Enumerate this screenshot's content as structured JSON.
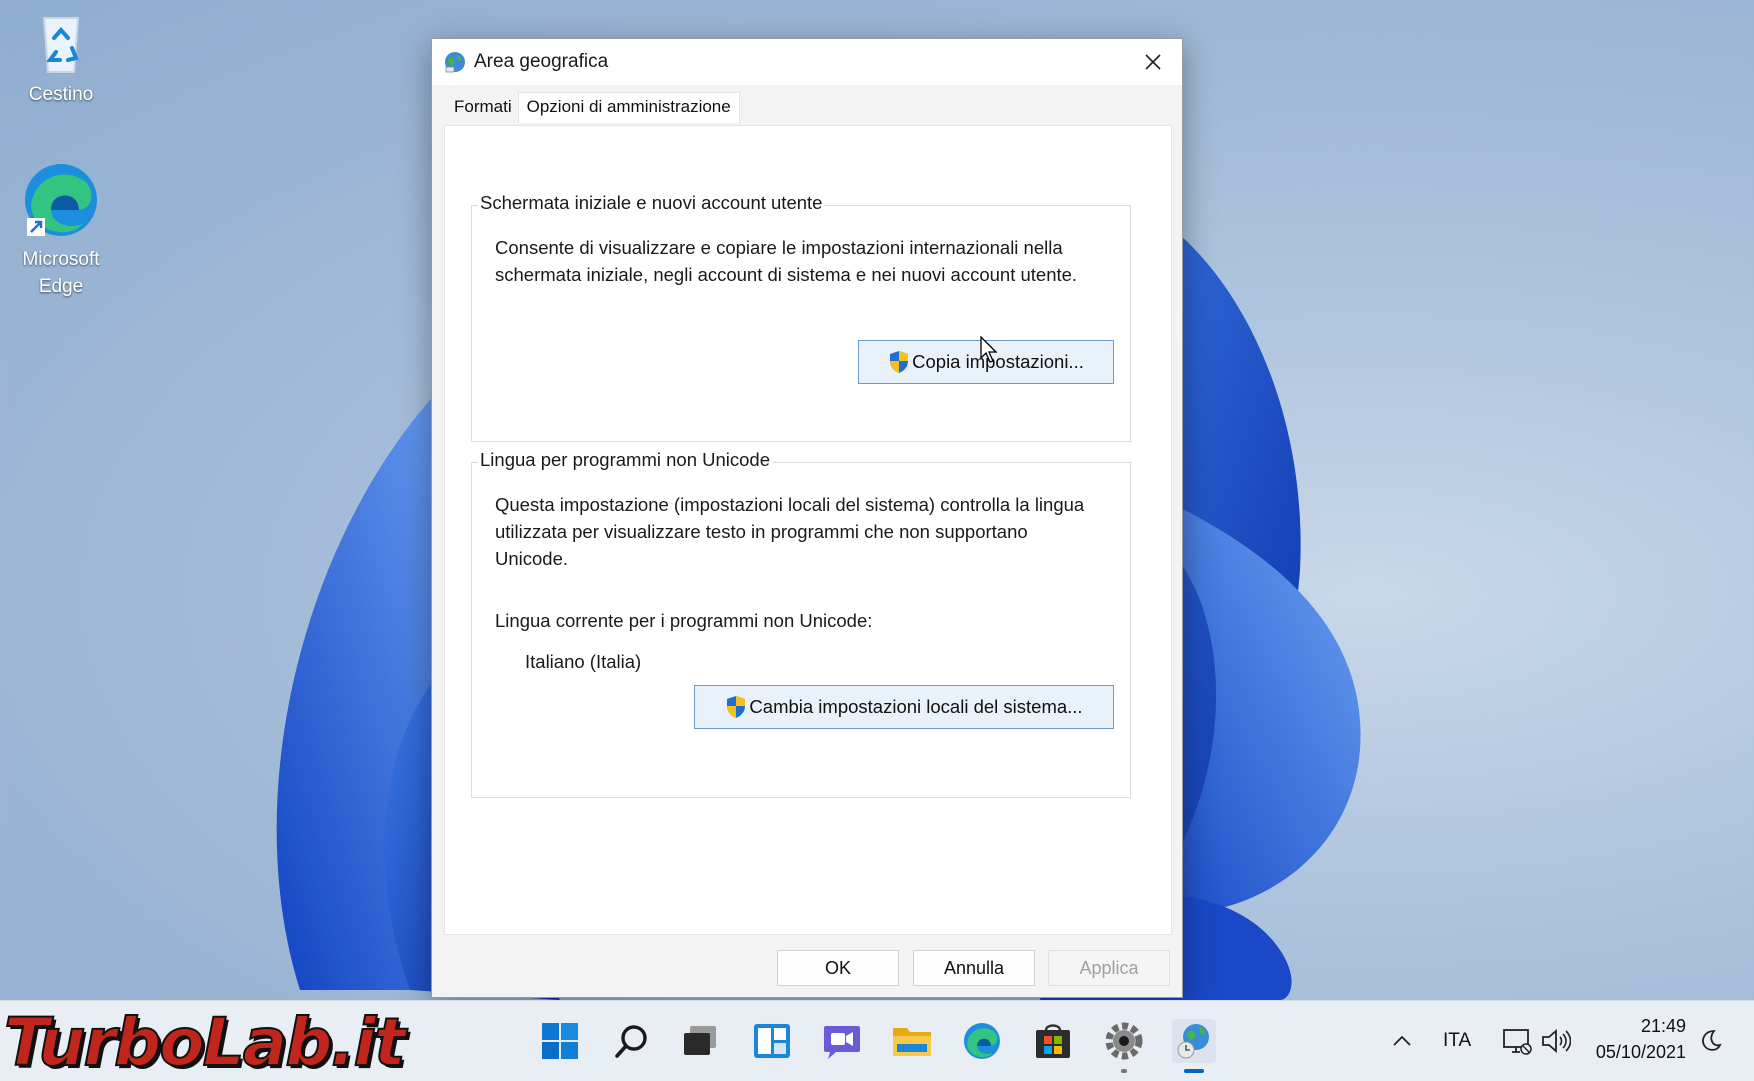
{
  "desktop": {
    "icons": [
      {
        "label": "Cestino",
        "icon": "recycle-bin-icon"
      },
      {
        "label": "Microsoft Edge",
        "icon": "edge-icon"
      }
    ]
  },
  "dialog": {
    "title": "Area geografica",
    "close_icon": "close-icon",
    "tabs": [
      {
        "label": "Formati",
        "active": false
      },
      {
        "label": "Opzioni di amministrazione",
        "active": true
      }
    ],
    "welcome_group": {
      "title": "Schermata iniziale e nuovi account utente",
      "description_line1": "Consente di visualizzare e copiare le impostazioni internazionali nella",
      "description_line2": "schermata iniziale, negli account di sistema e nei nuovi account utente.",
      "button_label": "Copia impostazioni..."
    },
    "unicode_group": {
      "title": "Lingua per programmi non Unicode",
      "description_line1": "Questa impostazione (impostazioni locali del sistema) controlla la lingua",
      "description_line2": "utilizzata per visualizzare testo in programmi che non supportano",
      "description_line3": "Unicode.",
      "current_label": "Lingua corrente per i programmi non Unicode:",
      "current_value": "Italiano (Italia)",
      "button_label": "Cambia impostazioni locali del sistema..."
    },
    "footer": {
      "ok": "OK",
      "cancel": "Annulla",
      "apply": "Applica"
    }
  },
  "taskbar": {
    "logo_text": "TurboLab.it",
    "apps": [
      "start-icon",
      "search-icon",
      "task-view-icon",
      "widgets-icon",
      "chat-icon",
      "file-explorer-icon",
      "edge-icon",
      "store-icon",
      "settings-icon",
      "region-globe-icon"
    ],
    "language": "ITA",
    "time": "21:49",
    "date": "05/10/2021"
  },
  "colors": {
    "accent": "#0067c0",
    "uac_button_border": "#6c9bd2",
    "uac_button_bg": "#e9f1fb",
    "logo_red": "#c0261b"
  }
}
